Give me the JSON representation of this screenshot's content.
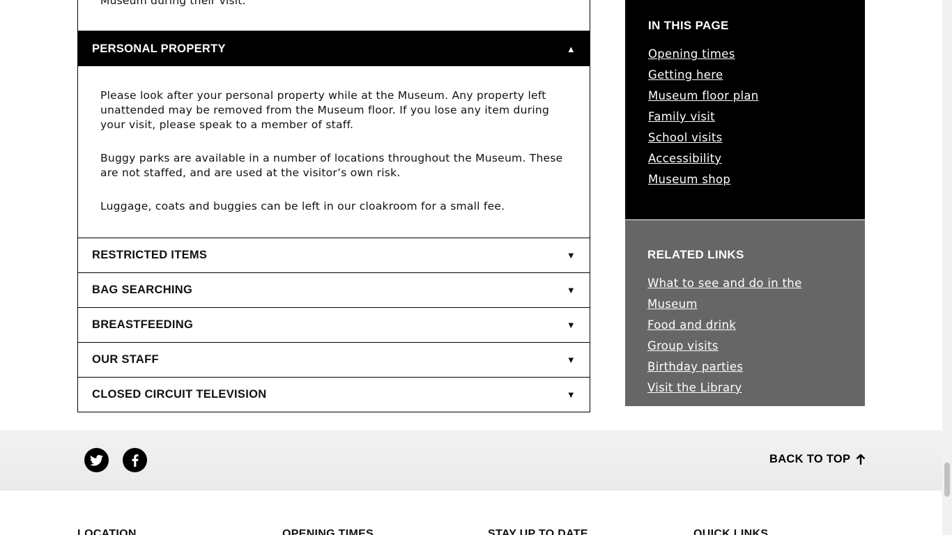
{
  "accordion": {
    "previous_tail": "Museum during their visit.",
    "items": [
      {
        "title": "PERSONAL PROPERTY",
        "open": true,
        "paragraphs": [
          "Please look after your personal property while at the Museum. Any property left unattended may be removed from the Museum floor. If you lose any item during your visit, please speak to a member of staff.",
          "Buggy parks are available in a number of locations throughout the Museum. These are not staffed, and are used at the visitor’s own risk.",
          "Luggage, coats and buggies can be left in our cloakroom for a small fee."
        ]
      },
      {
        "title": "RESTRICTED ITEMS",
        "open": false
      },
      {
        "title": "BAG SEARCHING",
        "open": false
      },
      {
        "title": "BREASTFEEDING",
        "open": false
      },
      {
        "title": "OUR STAFF",
        "open": false
      },
      {
        "title": "CLOSED CIRCUIT TELEVISION",
        "open": false
      }
    ],
    "arrow_open": "▲",
    "arrow_closed": "▼"
  },
  "in_this_page": {
    "title": "IN THIS PAGE",
    "links": [
      "Opening times",
      "Getting here",
      "Museum floor plan",
      "Family visit",
      "School visits",
      "Accessibility",
      "Museum shop"
    ]
  },
  "related_links": {
    "title": "RELATED LINKS",
    "links": [
      "What to see and do in the Museum",
      "Food and drink",
      "Group visits",
      "Birthday parties",
      "Visit the Library"
    ]
  },
  "footer": {
    "social": [
      {
        "icon": "twitter-icon"
      },
      {
        "icon": "facebook-icon"
      }
    ],
    "back_to_top": "BACK TO TOP",
    "columns": [
      "LOCATION",
      "OPENING TIMES",
      "STAY UP TO DATE",
      "QUICK LINKS"
    ]
  },
  "colors": {
    "black": "#000000",
    "sidebar_grey": "#666666",
    "footer_band": "#eeeeee"
  }
}
